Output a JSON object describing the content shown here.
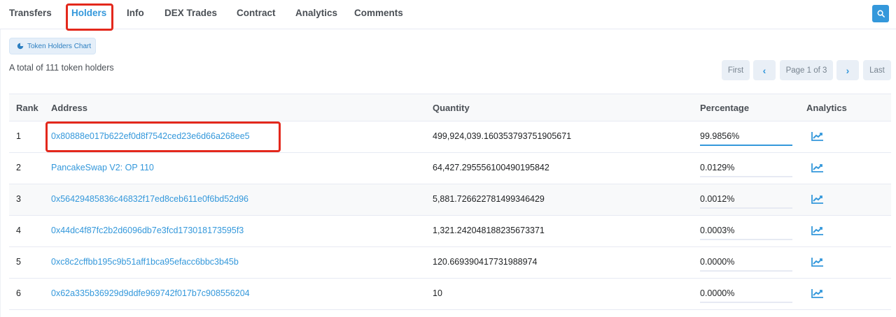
{
  "tabs": [
    {
      "label": "Transfers"
    },
    {
      "label": "Holders"
    },
    {
      "label": "Info"
    },
    {
      "label": "DEX Trades"
    },
    {
      "label": "Contract"
    },
    {
      "label": "Analytics"
    },
    {
      "label": "Comments"
    }
  ],
  "active_tab": "Holders",
  "chart_button": {
    "label": "Token Holders Chart"
  },
  "summary": {
    "total_text": "A total of 111 token holders"
  },
  "pagination": {
    "first": "First",
    "prev": "‹",
    "page": "Page 1 of 3",
    "next": "›",
    "last": "Last"
  },
  "table": {
    "headers": {
      "rank": "Rank",
      "address": "Address",
      "quantity": "Quantity",
      "percentage": "Percentage",
      "analytics": "Analytics"
    },
    "rows": [
      {
        "rank": "1",
        "address": "0x80888e017b622ef0d8f7542ced23e6d66a268ee5",
        "quantity": "499,924,039.160353793751905671",
        "percentage": "99.9856%",
        "pct": 99.9856
      },
      {
        "rank": "2",
        "address": "PancakeSwap V2: OP 110",
        "quantity": "64,427.295556100490195842",
        "percentage": "0.0129%",
        "pct": 0.0129
      },
      {
        "rank": "3",
        "address": "0x56429485836c46832f17ed8ceb611e0f6bd52d96",
        "quantity": "5,881.726622781499346429",
        "percentage": "0.0012%",
        "pct": 0.0012
      },
      {
        "rank": "4",
        "address": "0x44dc4f87fc2b2d6096db7e3fcd173018173595f3",
        "quantity": "1,321.242048188235673371",
        "percentage": "0.0003%",
        "pct": 0.0003
      },
      {
        "rank": "5",
        "address": "0xc8c2cffbb195c9b51aff1bca95efacc6bbc3b45b",
        "quantity": "120.669390417731988974",
        "percentage": "0.0000%",
        "pct": 0.0
      },
      {
        "rank": "6",
        "address": "0x62a335b36929d9ddfe969742f017b7c908556204",
        "quantity": "10",
        "percentage": "0.0000%",
        "pct": 0.0
      }
    ]
  },
  "colors": {
    "accent": "#3498db",
    "highlight": "#e3281c"
  }
}
